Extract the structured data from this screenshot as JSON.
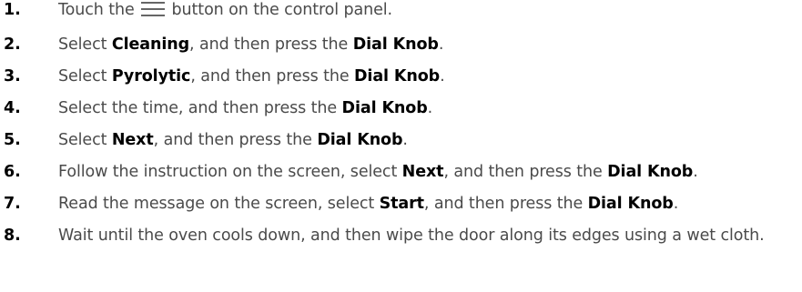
{
  "steps": [
    {
      "number": "1.",
      "parts": {
        "a": "Touch the",
        "b": "button on the control panel."
      },
      "icon": "menu-icon"
    },
    {
      "number": "2.",
      "parts": {
        "a": "Select",
        "b": "Cleaning",
        "c": ", and then press the",
        "d": "Dial Knob",
        "e": "."
      }
    },
    {
      "number": "3.",
      "parts": {
        "a": "Select",
        "b": "Pyrolytic",
        "c": ", and then press the",
        "d": "Dial Knob",
        "e": "."
      }
    },
    {
      "number": "4.",
      "parts": {
        "a": "Select the time, and then press the",
        "b": "Dial Knob",
        "c": "."
      }
    },
    {
      "number": "5.",
      "parts": {
        "a": "Select",
        "b": "Next",
        "c": ", and then press the",
        "d": "Dial Knob",
        "e": "."
      }
    },
    {
      "number": "6.",
      "parts": {
        "a": "Follow the instruction on the screen, select",
        "b": "Next",
        "c": ", and then press the",
        "d": "Dial Knob",
        "e": "."
      }
    },
    {
      "number": "7.",
      "parts": {
        "a": "Read the message on the screen, select",
        "b": "Start",
        "c": ", and then press the",
        "d": "Dial Knob",
        "e": "."
      }
    },
    {
      "number": "8.",
      "parts": {
        "a": "Wait until the oven cools down, and then wipe the door along its edges using a wet cloth."
      }
    }
  ],
  "colors": {
    "number": "#000000",
    "body_text": "#4a4a4a",
    "bold_text": "#000000",
    "background": "#ffffff"
  }
}
